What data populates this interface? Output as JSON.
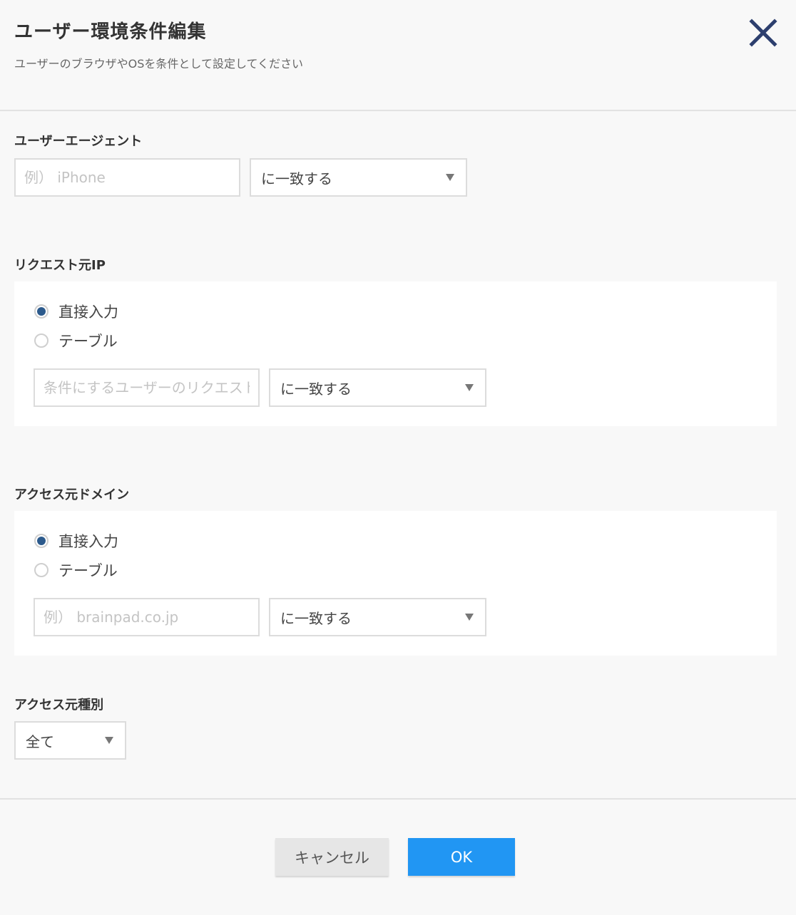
{
  "dialog": {
    "title": "ユーザー環境条件編集",
    "subtitle": "ユーザーのブラウザやOSを条件として設定してください",
    "close_icon": "close-icon"
  },
  "user_agent": {
    "label": "ユーザーエージェント",
    "input_placeholder": "例） iPhone",
    "match_value": "に一致する"
  },
  "request_ip": {
    "label": "リクエスト元IP",
    "radio_direct": "直接入力",
    "radio_table": "テーブル",
    "selected": "直接入力",
    "input_placeholder": "条件にするユーザーのリクエスト元IP",
    "match_value": "に一致する"
  },
  "access_domain": {
    "label": "アクセス元ドメイン",
    "radio_direct": "直接入力",
    "radio_table": "テーブル",
    "selected": "直接入力",
    "input_placeholder": "例） brainpad.co.jp",
    "match_value": "に一致する"
  },
  "access_type": {
    "label": "アクセス元種別",
    "value": "全て"
  },
  "footer": {
    "cancel_label": "キャンセル",
    "ok_label": "OK"
  },
  "colors": {
    "accent": "#2196f3",
    "radio_checked": "#2c5a8c",
    "close_icon": "#2d3f6e"
  }
}
